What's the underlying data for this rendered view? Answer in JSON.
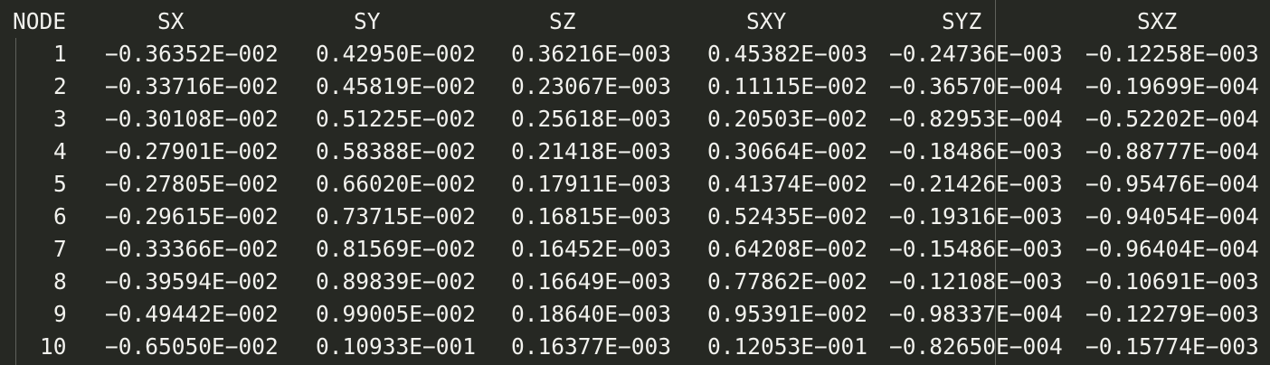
{
  "table": {
    "headers": [
      "NODE",
      "SX",
      "SY",
      "SZ",
      "SXY",
      "SYZ",
      "SXZ"
    ],
    "rows": [
      [
        "1",
        "−0.36352E−002",
        "0.42950E−002",
        "0.36216E−003",
        "0.45382E−003",
        "−0.24736E−003",
        "−0.12258E−003"
      ],
      [
        "2",
        "−0.33716E−002",
        "0.45819E−002",
        "0.23067E−003",
        "0.11115E−002",
        "−0.36570E−004",
        "−0.19699E−004"
      ],
      [
        "3",
        "−0.30108E−002",
        "0.51225E−002",
        "0.25618E−003",
        "0.20503E−002",
        "−0.82953E−004",
        "−0.52202E−004"
      ],
      [
        "4",
        "−0.27901E−002",
        "0.58388E−002",
        "0.21418E−003",
        "0.30664E−002",
        "−0.18486E−003",
        "−0.88777E−004"
      ],
      [
        "5",
        "−0.27805E−002",
        "0.66020E−002",
        "0.17911E−003",
        "0.41374E−002",
        "−0.21426E−003",
        "−0.95476E−004"
      ],
      [
        "6",
        "−0.29615E−002",
        "0.73715E−002",
        "0.16815E−003",
        "0.52435E−002",
        "−0.19316E−003",
        "−0.94054E−004"
      ],
      [
        "7",
        "−0.33366E−002",
        "0.81569E−002",
        "0.16452E−003",
        "0.64208E−002",
        "−0.15486E−003",
        "−0.96404E−004"
      ],
      [
        "8",
        "−0.39594E−002",
        "0.89839E−002",
        "0.16649E−003",
        "0.77862E−002",
        "−0.12108E−003",
        "−0.10691E−003"
      ],
      [
        "9",
        "−0.49442E−002",
        "0.99005E−002",
        "0.18640E−003",
        "0.95391E−002",
        "−0.98337E−004",
        "−0.12279E−003"
      ],
      [
        "10",
        "−0.65050E−002",
        "0.10933E−001",
        "0.16377E−003",
        "0.12053E−001",
        "−0.82650E−004",
        "−0.15774E−003"
      ]
    ]
  },
  "colors": {
    "background": "#262823",
    "text": "#f2f2ee",
    "guide": "#5f615b"
  }
}
